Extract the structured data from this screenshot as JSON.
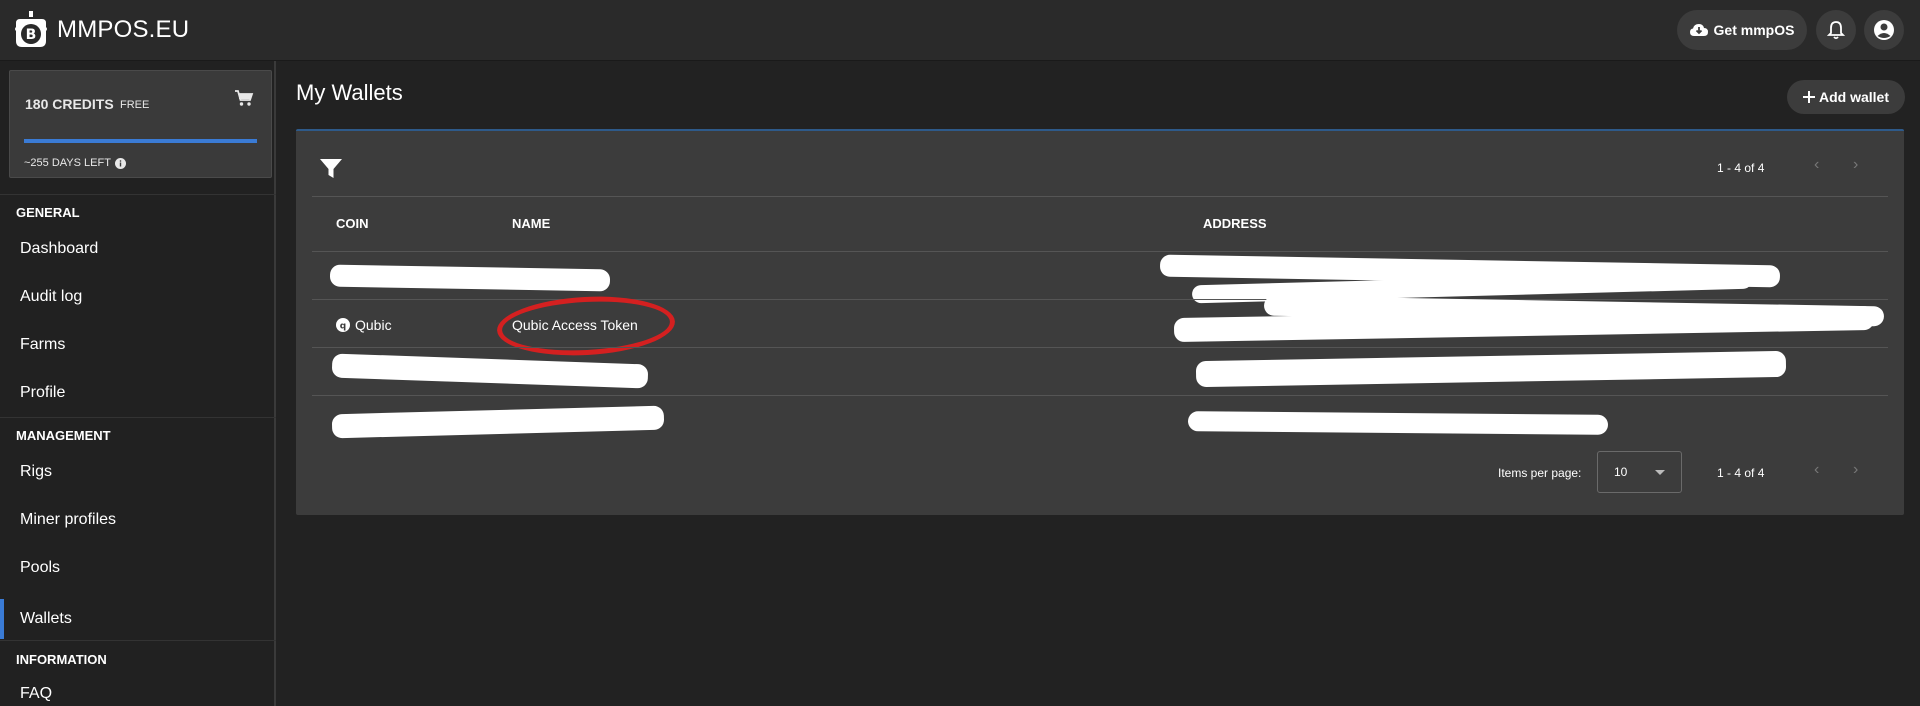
{
  "header": {
    "brand": "MMPOS.EU",
    "get_label": "Get mmpOS"
  },
  "sidebar": {
    "credits": "180 CREDITS",
    "plan": "FREE",
    "credits_progress_percent": 100,
    "days_left": "~255 DAYS LEFT",
    "sections": [
      {
        "title": "GENERAL",
        "items": [
          "Dashboard",
          "Audit log",
          "Farms",
          "Profile"
        ]
      },
      {
        "title": "MANAGEMENT",
        "items": [
          "Rigs",
          "Miner profiles",
          "Pools",
          "Wallets"
        ]
      },
      {
        "title": "INFORMATION",
        "items": [
          "FAQ"
        ]
      }
    ],
    "active_item": "Wallets"
  },
  "main": {
    "title": "My Wallets",
    "add_label": "Add wallet",
    "range_text": "1 - 4 of 4",
    "columns": [
      "COIN",
      "NAME",
      "ADDRESS"
    ],
    "rows": [
      {
        "coin": "",
        "name": "",
        "address": "",
        "redacted": true
      },
      {
        "coin": "Qubic",
        "name": "Qubic Access Token",
        "address": "",
        "address_redacted": true
      },
      {
        "coin": "",
        "name": "",
        "address": "",
        "redacted": true
      },
      {
        "coin": "",
        "name": "",
        "address": "",
        "redacted": true
      }
    ],
    "items_per_page_label": "Items per page:",
    "items_per_page": "10"
  },
  "icons": {
    "logo": "bitcoin-robot-icon",
    "get": "cloud-download-icon",
    "bell": "bell-icon",
    "account": "account-circle-icon",
    "cart": "cart-icon",
    "info": "info-icon",
    "plus": "plus-icon",
    "filter": "filter-icon",
    "coin": "qubic-coin-icon"
  },
  "colors": {
    "accent": "#3a7bd5",
    "annotation": "#d42020",
    "background": "#222222",
    "card": "#3c3c3c"
  }
}
